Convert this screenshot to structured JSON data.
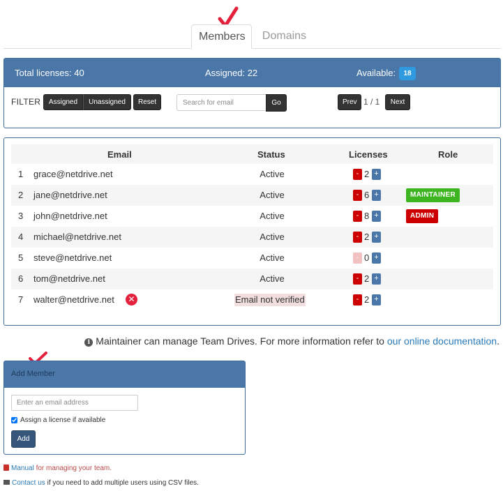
{
  "tabs": [
    {
      "label": "Members",
      "active": true
    },
    {
      "label": "Domains",
      "active": false
    }
  ],
  "summary": {
    "total_licenses": "Total licenses: 40",
    "assigned": "Assigned: 22",
    "available_label": "Available:",
    "available_value": "18"
  },
  "filter": {
    "label": "FILTER",
    "assigned_button": "Assigned",
    "unassigned_button": "Unassigned",
    "reset_button": "Reset",
    "search_placeholder": "Search for email",
    "go_button": "Go"
  },
  "pager": {
    "prev_button": "Prev",
    "page_text": "1 / 1",
    "next_button": "Next"
  },
  "table": {
    "headers": {
      "email": "Email",
      "status": "Status",
      "licenses": "Licenses",
      "role": "Role"
    },
    "rows": [
      {
        "num": "1",
        "email": "grace@netdrive.net",
        "status": "Active",
        "licenses": "2",
        "role": ""
      },
      {
        "num": "2",
        "email": "jane@netdrive.net",
        "status": "Active",
        "licenses": "6",
        "role": "MAINTAINER"
      },
      {
        "num": "3",
        "email": "john@netdrive.net",
        "status": "Active",
        "licenses": "8",
        "role": "ADMIN"
      },
      {
        "num": "4",
        "email": "michael@netdrive.net",
        "status": "Active",
        "licenses": "2",
        "role": ""
      },
      {
        "num": "5",
        "email": "steve@netdrive.net",
        "status": "Active",
        "licenses": "0",
        "role": ""
      },
      {
        "num": "6",
        "email": "tom@netdrive.net",
        "status": "Active",
        "licenses": "2",
        "role": ""
      },
      {
        "num": "7",
        "email": "walter@netdrive.net",
        "status": "Email not verified",
        "licenses": "2",
        "role": ""
      }
    ],
    "minus_symbol": "-",
    "plus_symbol": "+",
    "error_symbol": "✕"
  },
  "info": {
    "text": "Maintainer can manage Team Drives. For more information refer to",
    "link_text": "our online documentation",
    "period": "."
  },
  "add_member": {
    "title": "Add Member",
    "email_placeholder": "Enter an email address",
    "assign_label": "Assign a license if available",
    "assign_checked": true,
    "add_button": "Add"
  },
  "footer": {
    "manual_link": "Manual",
    "manual_text": "for managing your team.",
    "contact_link": "Contact us",
    "contact_text": "if you need to add multiple users using CSV files."
  },
  "colors": {
    "panel_header": "#4a76a8",
    "available_badge": "#2f9ae0",
    "maintainer_badge": "#3cb521",
    "admin_badge": "#cc0000",
    "checkmark": "#e3213c",
    "link": "#2a7ab8"
  },
  "icons": [
    "checkmark-icon",
    "error-circle-icon",
    "info-icon",
    "book-icon",
    "envelope-icon"
  ]
}
